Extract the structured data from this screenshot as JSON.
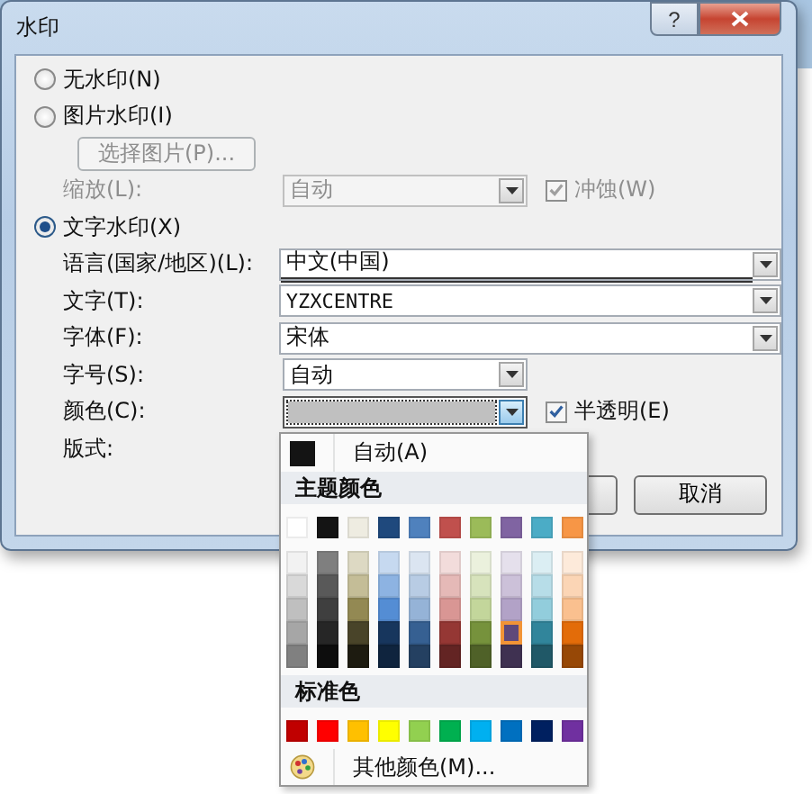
{
  "window": {
    "title": "水印",
    "help": "?"
  },
  "watermark_types": [
    {
      "label": "无水印(N)",
      "selected": false
    },
    {
      "label": "图片水印(I)",
      "selected": false
    },
    {
      "label": "文字水印(X)",
      "selected": true
    }
  ],
  "picture_options": {
    "select_button": {
      "label": "选择图片(P)...",
      "disabled": true
    },
    "scale": {
      "label": "缩放(L):",
      "value": "自动",
      "disabled": true
    },
    "washout": {
      "label": "冲蚀(W)",
      "checked": true,
      "disabled": true
    }
  },
  "text_options": {
    "language": {
      "label": "语言(国家/地区)(L):",
      "value": "中文(中国)"
    },
    "text": {
      "label": "文字(T):",
      "value": "YZXCENTRE"
    },
    "font": {
      "label": "字体(F):",
      "value": "宋体"
    },
    "size": {
      "label": "字号(S):",
      "value": "自动"
    },
    "color": {
      "label": "颜色(C):",
      "color": "#c0c0c0"
    },
    "semitransparent": {
      "label": "半透明(E)",
      "checked": true
    },
    "layout": {
      "label": "版式:"
    }
  },
  "buttons": [
    {
      "label": "取消"
    }
  ],
  "color_menu": {
    "auto": {
      "label": "自动(A)",
      "color": "#141414"
    },
    "theme_header": "主题颜色",
    "theme_colors": [
      {
        "color": "#ffffff",
        "selected": false
      },
      {
        "color": "#141414",
        "selected": false
      },
      {
        "color": "#eeece1",
        "selected": false
      },
      {
        "color": "#1f497d",
        "selected": false
      },
      {
        "color": "#4f81bd",
        "selected": false
      },
      {
        "color": "#c0504d",
        "selected": false
      },
      {
        "color": "#9bbb59",
        "selected": false
      },
      {
        "color": "#8064a2",
        "selected": false
      },
      {
        "color": "#4bacc6",
        "selected": false
      },
      {
        "color": "#f79646",
        "selected": false
      }
    ],
    "theme_shades": [
      [
        {
          "color": "#f2f2f2",
          "selected": false
        },
        {
          "color": "#d9d9d9",
          "selected": false
        },
        {
          "color": "#bfbfbf",
          "selected": false
        },
        {
          "color": "#a6a6a6",
          "selected": false
        },
        {
          "color": "#808080",
          "selected": false
        }
      ],
      [
        {
          "color": "#7f7f7f",
          "selected": false
        },
        {
          "color": "#595959",
          "selected": false
        },
        {
          "color": "#3f3f3f",
          "selected": false
        },
        {
          "color": "#262626",
          "selected": false
        },
        {
          "color": "#0d0d0d",
          "selected": false
        }
      ],
      [
        {
          "color": "#ddd9c3",
          "selected": false
        },
        {
          "color": "#c4bd97",
          "selected": false
        },
        {
          "color": "#938953",
          "selected": false
        },
        {
          "color": "#494429",
          "selected": false
        },
        {
          "color": "#1d1b10",
          "selected": false
        }
      ],
      [
        {
          "color": "#c6d9f0",
          "selected": false
        },
        {
          "color": "#8db3e2",
          "selected": false
        },
        {
          "color": "#548dd4",
          "selected": false
        },
        {
          "color": "#17365d",
          "selected": false
        },
        {
          "color": "#0f243e",
          "selected": false
        }
      ],
      [
        {
          "color": "#dbe5f1",
          "selected": false
        },
        {
          "color": "#b8cce4",
          "selected": false
        },
        {
          "color": "#95b3d7",
          "selected": false
        },
        {
          "color": "#366092",
          "selected": false
        },
        {
          "color": "#244061",
          "selected": false
        }
      ],
      [
        {
          "color": "#f2dcdb",
          "selected": false
        },
        {
          "color": "#e5b9b7",
          "selected": false
        },
        {
          "color": "#d99694",
          "selected": false
        },
        {
          "color": "#953734",
          "selected": false
        },
        {
          "color": "#632423",
          "selected": false
        }
      ],
      [
        {
          "color": "#ebf1dd",
          "selected": false
        },
        {
          "color": "#d7e3bc",
          "selected": false
        },
        {
          "color": "#c3d69b",
          "selected": false
        },
        {
          "color": "#76923c",
          "selected": false
        },
        {
          "color": "#4f6128",
          "selected": false
        }
      ],
      [
        {
          "color": "#e5e0ec",
          "selected": false
        },
        {
          "color": "#ccc1d9",
          "selected": false
        },
        {
          "color": "#b2a2c7",
          "selected": false
        },
        {
          "color": "#5f497a",
          "selected": true
        },
        {
          "color": "#3f3151",
          "selected": false
        }
      ],
      [
        {
          "color": "#dbeef3",
          "selected": false
        },
        {
          "color": "#b7dde8",
          "selected": false
        },
        {
          "color": "#92cddc",
          "selected": false
        },
        {
          "color": "#31859b",
          "selected": false
        },
        {
          "color": "#205867",
          "selected": false
        }
      ],
      [
        {
          "color": "#fdeada",
          "selected": false
        },
        {
          "color": "#fbd5b5",
          "selected": false
        },
        {
          "color": "#fac08f",
          "selected": false
        },
        {
          "color": "#e36c09",
          "selected": false
        },
        {
          "color": "#974806",
          "selected": false
        }
      ]
    ],
    "standard_header": "标准色",
    "standard_colors": [
      {
        "color": "#c00000",
        "selected": false
      },
      {
        "color": "#ff0000",
        "selected": false
      },
      {
        "color": "#ffc000",
        "selected": false
      },
      {
        "color": "#ffff00",
        "selected": false
      },
      {
        "color": "#92d050",
        "selected": false
      },
      {
        "color": "#00b050",
        "selected": false
      },
      {
        "color": "#00b0f0",
        "selected": false
      },
      {
        "color": "#0070c0",
        "selected": false
      },
      {
        "color": "#002060",
        "selected": false
      },
      {
        "color": "#7030a0",
        "selected": false
      }
    ],
    "more_colors": "其他颜色(M)..."
  }
}
